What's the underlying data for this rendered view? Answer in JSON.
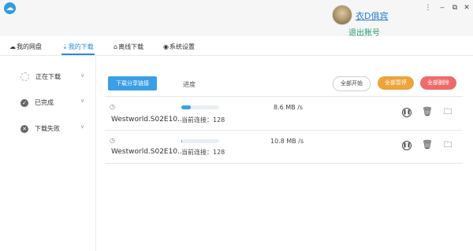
{
  "titlebar": {
    "username": "衣D俱宾",
    "logout_label": "退出账号",
    "controls": [
      "⋮",
      "‒",
      "⧉",
      "✕"
    ]
  },
  "nav": {
    "tabs": [
      {
        "label": "我的网盘",
        "icon": "cloud-icon",
        "active": false
      },
      {
        "label": "我的下载",
        "icon": "download-icon",
        "active": true
      },
      {
        "label": "离线下载",
        "icon": "offline-icon",
        "active": false
      },
      {
        "label": "系统设置",
        "icon": "settings-icon",
        "active": false
      }
    ]
  },
  "sidebar": {
    "items": [
      {
        "label": "正在下载",
        "icon": "spinner-icon"
      },
      {
        "label": "已完成",
        "icon": "check-circle-icon"
      },
      {
        "label": "下载失败",
        "icon": "x-circle-icon"
      }
    ]
  },
  "toolbar": {
    "share_link_label": "下载分享链接",
    "progress_header": "进度",
    "start_all_label": "全部开始",
    "pause_all_label": "全部暂停",
    "delete_all_label": "全部删除"
  },
  "downloads": [
    {
      "filename": "Westworld.S02E10...",
      "progress": 0.25,
      "connections": "当前连接：128",
      "speed": "8.6 MB /s"
    },
    {
      "filename": "Westworld.S02E10...",
      "progress": 0.02,
      "connections": "当前连接：128",
      "speed": "10.8 MB /s"
    }
  ],
  "colors": {
    "accent": "#2b8ae6",
    "primary_button": "#3a9fe6",
    "pause_all": "#eca43b",
    "delete_all": "#ef6a6a",
    "logout_link": "#22a06b"
  }
}
